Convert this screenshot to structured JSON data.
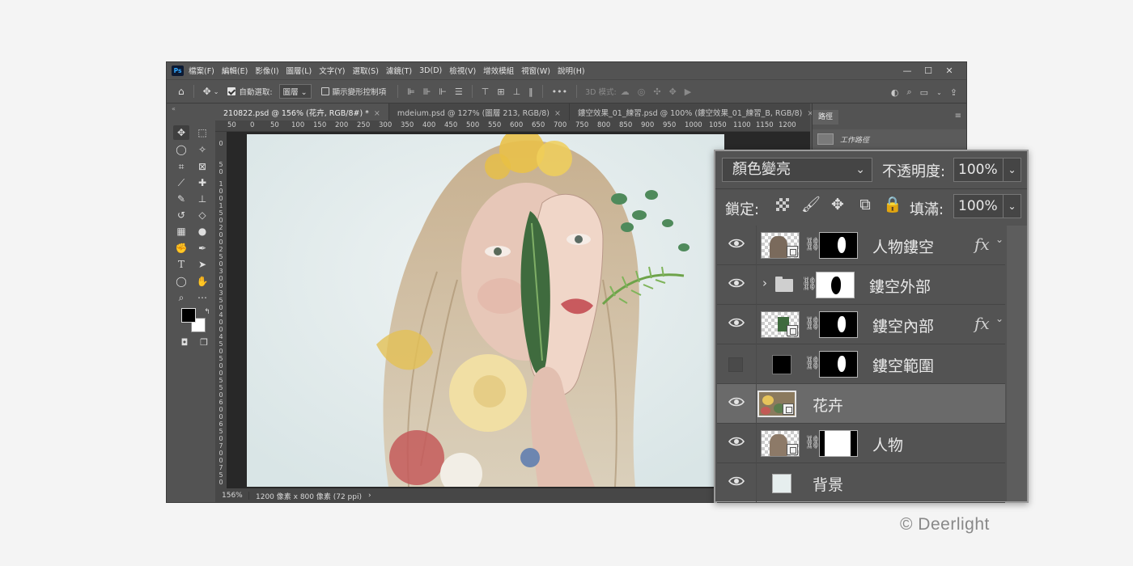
{
  "menubar": {
    "logo": "Ps",
    "items": [
      "檔案(F)",
      "編輯(E)",
      "影像(I)",
      "圖層(L)",
      "文字(Y)",
      "選取(S)",
      "濾鏡(T)",
      "3D(D)",
      "檢視(V)",
      "增效模組",
      "視窗(W)",
      "說明(H)"
    ],
    "controls": [
      "—",
      "☐",
      "✕"
    ]
  },
  "options": {
    "auto_select_label": "自動選取:",
    "auto_select_value": "圖層",
    "show_transform_label": "顯示變形控制項",
    "more": "•••",
    "mode_3d": "3D 模式:"
  },
  "tabs": [
    {
      "label": "210822.psd @ 156% (花卉, RGB/8#) *",
      "close": "×"
    },
    {
      "label": "mdeium.psd @ 127% (圖層 213, RGB/8)",
      "close": "×"
    },
    {
      "label": "鏤空效果_01_練習.psd @ 100% (鏤空效果_01_練習_B, RGB/8)",
      "close": "×"
    }
  ],
  "ruler": {
    "top": [
      "50",
      "0",
      "50",
      "100",
      "150",
      "200",
      "250",
      "300",
      "350",
      "400",
      "450",
      "500",
      "550",
      "600",
      "650",
      "700",
      "750",
      "800",
      "850",
      "900",
      "950",
      "1000",
      "1050",
      "1100",
      "1150",
      "1200"
    ],
    "left": [
      "0",
      "5 0",
      "1 0 0",
      "1 5 0",
      "2 0 0",
      "2 5 0",
      "3 0 0",
      "3 5 0",
      "4 0 0",
      "4 5 0",
      "5 0 0",
      "5 5 0",
      "6 0 0",
      "6 5 0",
      "7 0 0",
      "7 5 0"
    ]
  },
  "status": {
    "zoom": "156%",
    "info": "1200 像素 x 800 像素 (72 ppi)",
    "arrow": "›"
  },
  "paths": {
    "tab": "路徑",
    "item": "工作路徑"
  },
  "layers_panel": {
    "blend_mode": "顏色變亮",
    "opacity_label": "不透明度:",
    "opacity_value": "100%",
    "lock_label": "鎖定:",
    "fill_label": "填滿:",
    "fill_value": "100%",
    "layers": [
      {
        "name": "人物鏤空",
        "visible": true,
        "fx": "fx"
      },
      {
        "name": "鏤空外部",
        "visible": true,
        "group": true
      },
      {
        "name": "鏤空內部",
        "visible": true,
        "fx": "fx"
      },
      {
        "name": "鏤空範圍",
        "visible": false
      },
      {
        "name": "花卉",
        "visible": true,
        "selected": true
      },
      {
        "name": "人物",
        "visible": true
      },
      {
        "name": "背景",
        "visible": true
      }
    ]
  },
  "copyright": "© Deerlight"
}
